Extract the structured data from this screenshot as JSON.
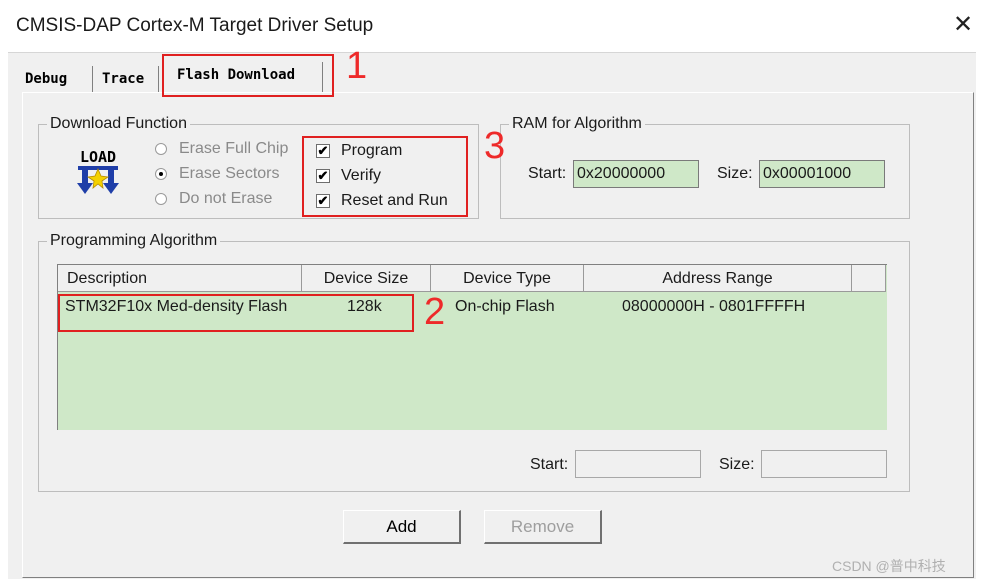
{
  "window": {
    "title": "CMSIS-DAP Cortex-M Target Driver Setup",
    "close_glyph": "✕"
  },
  "tabs": [
    {
      "label": "Debug"
    },
    {
      "label": "Trace"
    },
    {
      "label": "Flash Download"
    }
  ],
  "download_function": {
    "group_label": "Download Function",
    "load_icon_text": "LOAD",
    "radios": [
      {
        "label": "Erase Full Chip"
      },
      {
        "label": "Erase Sectors"
      },
      {
        "label": "Do not Erase"
      }
    ],
    "checkboxes": [
      {
        "label": "Program",
        "mark": "✔"
      },
      {
        "label": "Verify",
        "mark": "✔"
      },
      {
        "label": "Reset and Run",
        "mark": "✔"
      }
    ]
  },
  "ram": {
    "group_label": "RAM for Algorithm",
    "start_label": "Start:",
    "start_value": "0x20000000",
    "size_label": "Size:",
    "size_value": "0x00001000"
  },
  "programming": {
    "group_label": "Programming Algorithm",
    "columns": [
      "Description",
      "Device Size",
      "Device Type",
      "Address Range"
    ],
    "rows": [
      {
        "description": "STM32F10x Med-density Flash",
        "size": "128k",
        "type": "On-chip Flash",
        "range": "08000000H - 0801FFFFH"
      }
    ],
    "start_label": "Start:",
    "size_label": "Size:"
  },
  "buttons": {
    "add": "Add",
    "remove": "Remove"
  },
  "annotations": [
    "1",
    "2",
    "3"
  ],
  "watermark": "CSDN @普中科技"
}
